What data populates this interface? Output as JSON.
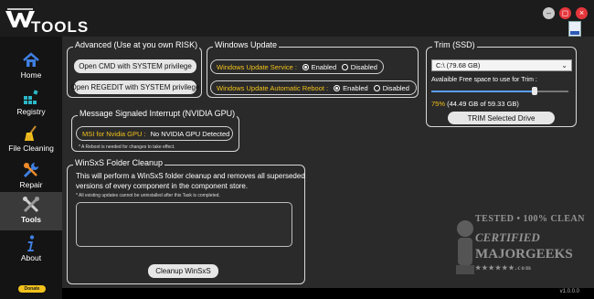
{
  "app": {
    "logo_text": "TOOLS",
    "window_buttons": {
      "minimize_glyph": "–",
      "maximize_glyph": "◻",
      "close_glyph": "×"
    }
  },
  "sidebar": {
    "items": [
      {
        "label": "Home",
        "icon": "home-icon"
      },
      {
        "label": "Registry",
        "icon": "registry-icon"
      },
      {
        "label": "File Cleaning",
        "icon": "broom-icon"
      },
      {
        "label": "Repair",
        "icon": "wrench-icon"
      },
      {
        "label": "Tools",
        "icon": "tools-icon"
      },
      {
        "label": "About",
        "icon": "info-icon"
      }
    ],
    "active": "Tools",
    "donate_label": "Donate"
  },
  "advanced": {
    "title": "Advanced (Use at you own RISK)",
    "cmd_button": "Open CMD with SYSTEM privilege",
    "regedit_button": "Open REGEDIT with SYSTEM privilege"
  },
  "windows_update": {
    "title": "Windows Update",
    "service_label": "Windows Update Service :",
    "service_enabled": "Enabled",
    "service_disabled": "Disabled",
    "service_selected": "Enabled",
    "reboot_label": "Windows Update Automatic Reboot :",
    "reboot_enabled": "Enabled",
    "reboot_disabled": "Disabled",
    "reboot_selected": "Enabled"
  },
  "msi": {
    "title": "Message Signaled Interrupt (NVIDIA GPU)",
    "label": "MSI for Nvidia GPU :",
    "value": "No NVIDIA GPU Detected",
    "note": "* A Reboot is needed for changes to take effect."
  },
  "trim": {
    "title": "Trim (SSD)",
    "drive": "C:\\  (79.68 GB)",
    "slider_label": "Avalaible Free space to use for Trim :",
    "slider_fraction": 0.75,
    "percent_text": "75%",
    "size_text": "(44.49 GB of 59.33 GB)",
    "button": "TRIM Selected Drive"
  },
  "winsxs": {
    "title": "WinSxS Folder Cleanup",
    "description_line1": "This will perform a WinSxS folder cleanup and removes all superseded",
    "description_line2": "versions of every component in the component store.",
    "note": "* All existing updates cannot be uninstalled after this Task is completed.",
    "log_text": "",
    "button": "Cleanup WinSxS"
  },
  "version": "v1.0.0.0",
  "watermark": {
    "line1": "TESTED • 100% CLEAN",
    "line2": "CERTIFIED",
    "line3": "MAJORGEEKS",
    "line4": "★★★★★★.com"
  },
  "colors": {
    "accent_yellow": "#f2c21c",
    "close_red": "#e5363b",
    "slider_blue": "#5aa0ff"
  }
}
